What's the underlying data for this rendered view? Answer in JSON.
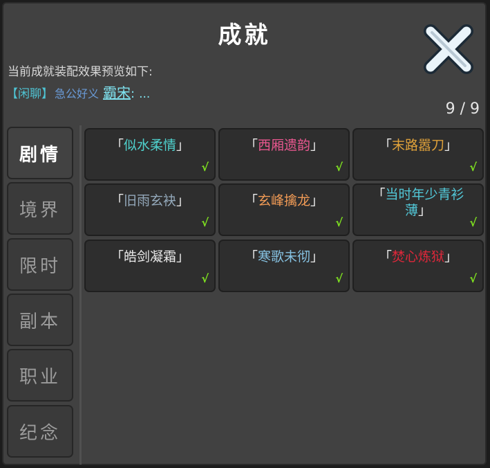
{
  "window": {
    "title": "成就"
  },
  "preview": {
    "label": "当前成就装配效果预览如下:",
    "tag": "【闲聊】",
    "player_name": "急公好义",
    "title": "霸宋",
    "colon": ":",
    "ellipsis": "..."
  },
  "count": "9 / 9",
  "sidebar": {
    "tabs": [
      {
        "label": "剧情",
        "active": true
      },
      {
        "label": "境界",
        "active": false
      },
      {
        "label": "限时",
        "active": false
      },
      {
        "label": "副本",
        "active": false
      },
      {
        "label": "职业",
        "active": false
      },
      {
        "label": "纪念",
        "active": false
      }
    ]
  },
  "achievements": [
    {
      "open": "「",
      "name": "似水柔情",
      "close": "」",
      "color": "#4fd3cf",
      "equipped": "√"
    },
    {
      "open": "「",
      "name": "西厢遗韵",
      "close": "」",
      "color": "#e8578f",
      "equipped": "√"
    },
    {
      "open": "「",
      "name": "末路嚣刀",
      "close": "」",
      "color": "#e0a23a",
      "equipped": "√"
    },
    {
      "open": "「",
      "name": "旧雨玄袂",
      "close": "」",
      "color": "#93a8ba",
      "equipped": "√"
    },
    {
      "open": "「",
      "name": "玄峰擒龙",
      "close": "」",
      "color": "#f09a55",
      "equipped": "√"
    },
    {
      "open": "「",
      "name": "当时年少青衫薄",
      "close": "」",
      "color": "#52c8d8",
      "equipped": "√"
    },
    {
      "open": "「",
      "name": "皓剑凝霜",
      "close": "」",
      "color": "#e9e9e9",
      "equipped": "√"
    },
    {
      "open": "「",
      "name": "寒歌未彻",
      "close": "」",
      "color": "#86c2e2",
      "equipped": "√"
    },
    {
      "open": "「",
      "name": "焚心炼狱",
      "close": "」",
      "color": "#e0273a",
      "equipped": "√"
    }
  ],
  "icons": {
    "close": "close-x-icon"
  },
  "colors": {
    "panel": "#414141",
    "card": "#2e2e2e",
    "check": "#7ee020"
  }
}
